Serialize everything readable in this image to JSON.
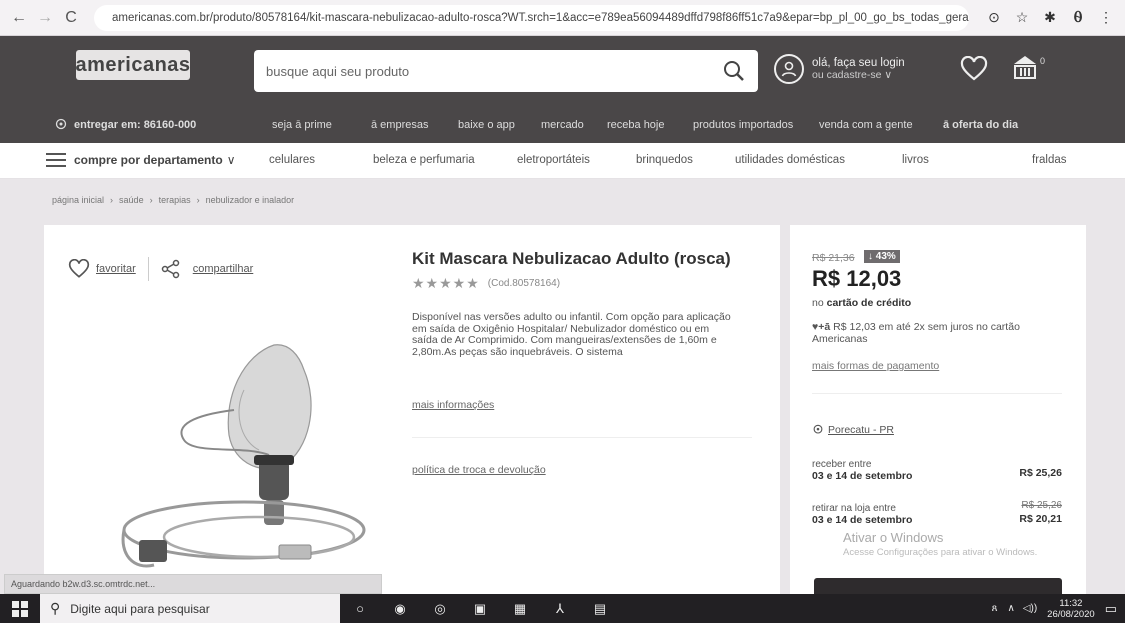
{
  "browser": {
    "url": "americanas.com.br/produto/80578164/kit-mascara-nebulizacao-adulto-rosca?WT.srch=1&acc=e789ea56094489dffd798f86ff51c7a9&epar=bp_pl_00_go_bs_todas_gera..."
  },
  "header": {
    "logo": "americanas",
    "search_placeholder": "busque aqui seu produto",
    "account_line1": "olá, faça seu login",
    "account_line2": "ou cadastre-se ∨",
    "cart_count": "0"
  },
  "promo": {
    "location": "entregar em: 86160-000",
    "items": [
      "seja ā prime",
      "ā empresas",
      "baixe o app",
      "mercado",
      "receba hoje",
      "produtos importados",
      "venda com a gente",
      "ā oferta do dia"
    ]
  },
  "catnav": {
    "dept": "compre por departamento",
    "items": [
      "celulares",
      "beleza e perfumaria",
      "eletroportáteis",
      "brinquedos",
      "utilidades domésticas",
      "livros",
      "fraldas"
    ]
  },
  "breadcrumb": [
    "página inicial",
    "saúde",
    "terapias",
    "nebulizador e inalador"
  ],
  "product": {
    "favorite": "favoritar",
    "share": "compartilhar",
    "title": "Kit Mascara Nebulizacao Adulto (rosca)",
    "code": "(Cod.80578164)",
    "description": "Disponível nas versões adulto ou infantil. Com opção para aplicação em saída de Oxigênio Hospitalar/ Nebulizador doméstico ou em saída de Ar Comprimido. Com mangueiras/extensões de 1,60m e 2,80m.As peças são inquebráveis. O sistema",
    "more_info": "mais informações",
    "returns": "política de troca e devolução"
  },
  "price": {
    "old": "R$ 21,36",
    "discount": "↓ 43%",
    "current": "R$ 12,03",
    "note_prefix": "no",
    "note_bold": "cartão de crédito",
    "installments": "R$ 12,03 em até 2x sem juros no cartão Americanas",
    "payment_link": "mais formas de pagamento",
    "city": "Porecatu - PR",
    "delivery_label": "receber entre",
    "delivery_dates": "03 e 14 de setembro",
    "delivery_price": "R$ 25,26",
    "pickup_label": "retirar na loja entre",
    "pickup_dates": "03 e 14 de setembro",
    "pickup_old": "R$ 25,26",
    "pickup_price": "R$ 20,21"
  },
  "watermark": {
    "title": "Ativar o Windows",
    "sub": "Acesse Configurações para ativar o Windows."
  },
  "status": "Aguardando b2w.d3.sc.omtrdc.net...",
  "taskbar": {
    "search": "Digite aqui para pesquisar",
    "time": "11:32",
    "date": "26/08/2020"
  }
}
